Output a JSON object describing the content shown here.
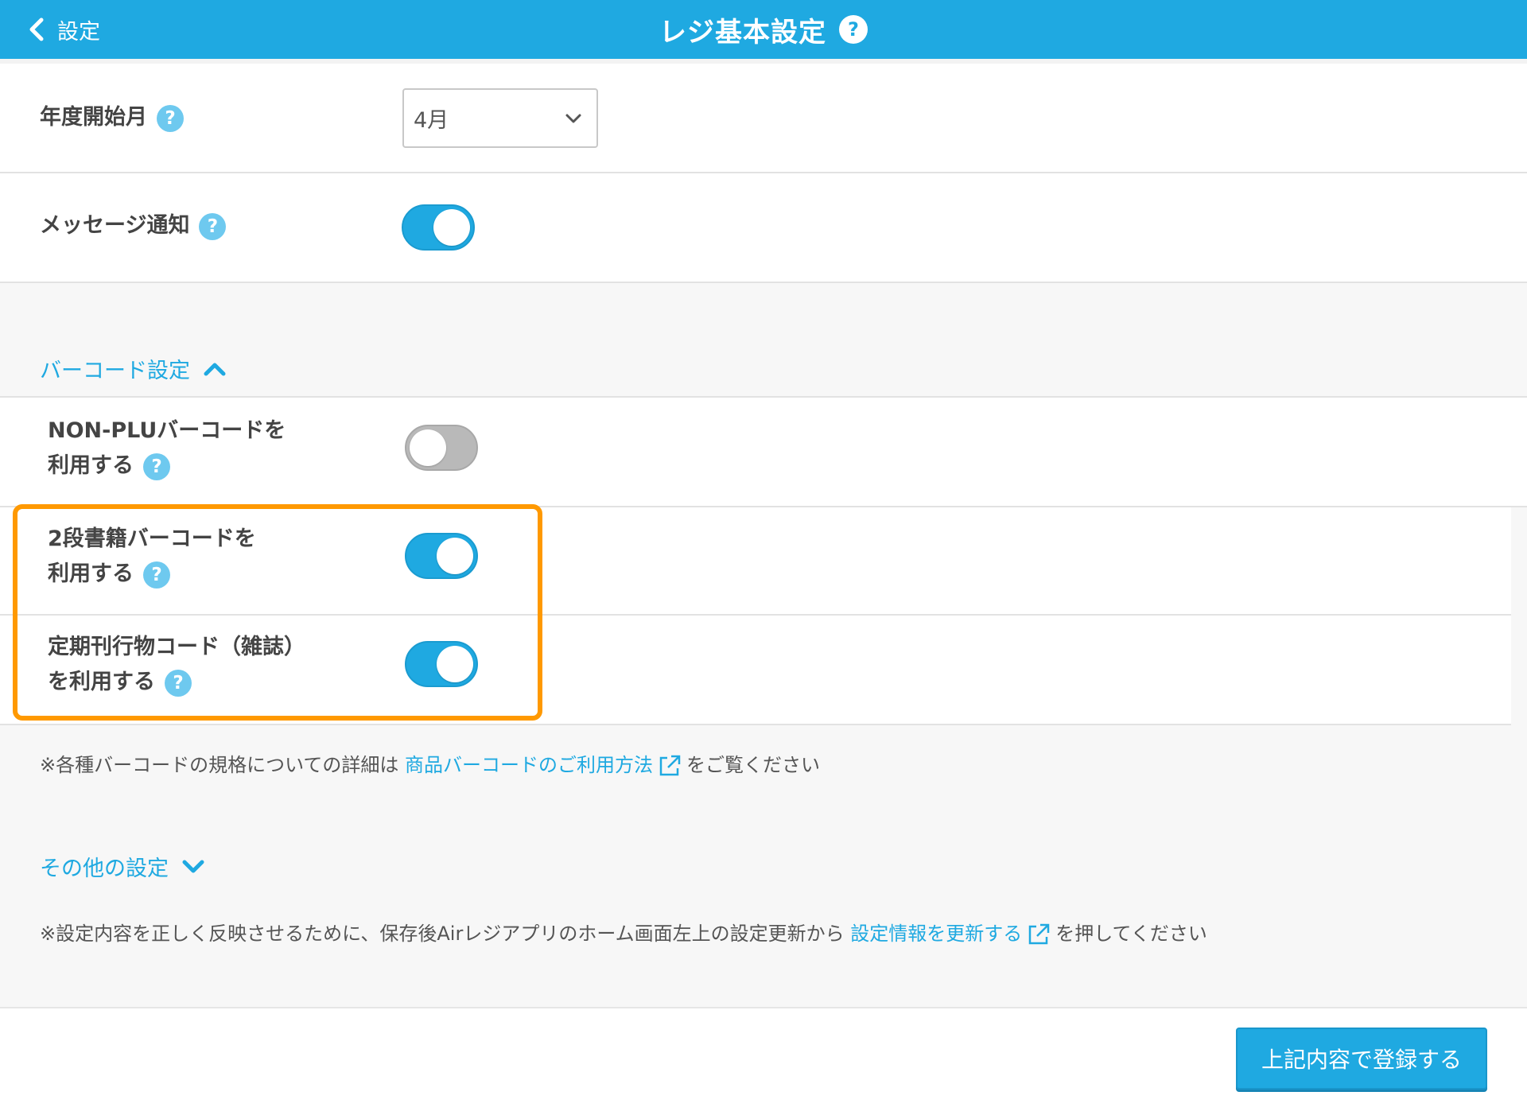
{
  "header": {
    "back_label": "設定",
    "title": "レジ基本設定",
    "help": "?"
  },
  "fiscal_month": {
    "label": "年度開始月",
    "help": "?",
    "value": "4月"
  },
  "message_notice": {
    "label": "メッセージ通知",
    "help": "?",
    "enabled": true
  },
  "barcode_section": {
    "label": "バーコード設定",
    "expanded": true,
    "items": [
      {
        "line1": "NON-PLUバーコードを",
        "line2": "利用する",
        "help": "?",
        "enabled": false
      },
      {
        "line1": "2段書籍バーコードを",
        "line2": "利用する",
        "help": "?",
        "enabled": true
      },
      {
        "line1": "定期刊行物コード（雑誌）",
        "line2": "を利用する",
        "help": "?",
        "enabled": true
      }
    ],
    "note_prefix": "※各種バーコードの規格についての詳細は",
    "note_link": "商品バーコードのご利用方法",
    "note_suffix": "をご覧ください"
  },
  "other_section": {
    "label": "その他の設定",
    "expanded": false
  },
  "sync_note": {
    "prefix": "※設定内容を正しく反映させるために、保存後Airレジアプリのホーム画面左上の設定更新から",
    "link": "設定情報を更新する",
    "suffix": "を押してください"
  },
  "footer": {
    "submit_label": "上記内容で登録する"
  },
  "colors": {
    "accent": "#1fa9e1",
    "highlight": "#ff9900",
    "toggle_off": "#b9b9b9"
  },
  "icons": {
    "back": "chevron-left-icon",
    "help": "question-circle-icon",
    "select": "chevron-down-icon",
    "expand": "chevron-up-icon",
    "collapse": "chevron-down-icon",
    "external": "external-link-icon"
  }
}
